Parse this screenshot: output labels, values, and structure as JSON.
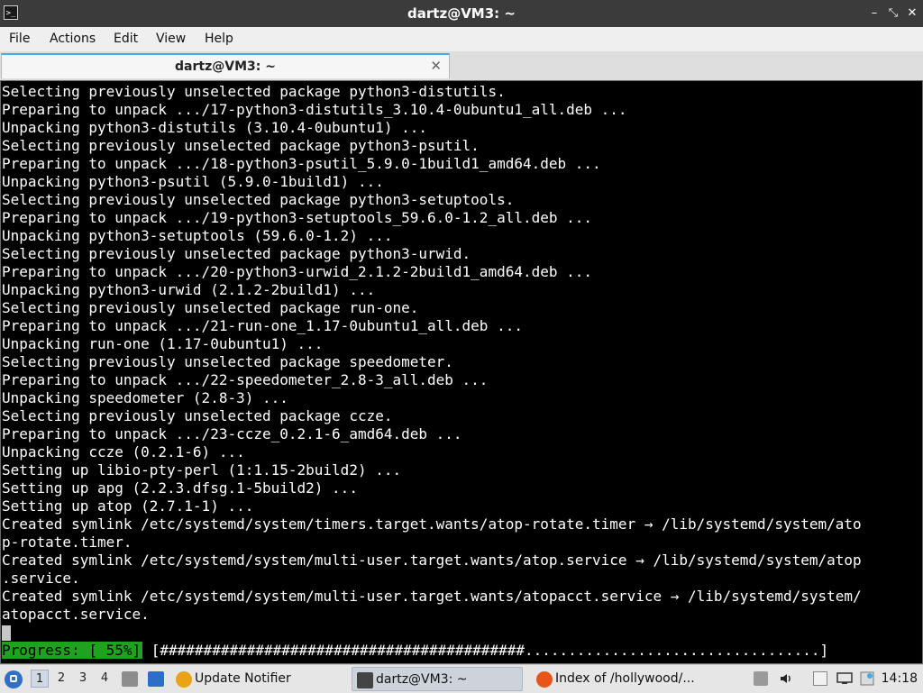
{
  "window": {
    "title": "dartz@VM3: ~",
    "app_icon": "terminal-icon",
    "controls": {
      "minimize": "–",
      "maximize": "⤡",
      "close": "✕"
    }
  },
  "menubar": {
    "items": [
      "File",
      "Actions",
      "Edit",
      "View",
      "Help"
    ]
  },
  "tabs": [
    {
      "label": "dartz@VM3: ~",
      "close": "✕"
    }
  ],
  "terminal": {
    "lines": [
      "Selecting previously unselected package python3-distutils.",
      "Preparing to unpack .../17-python3-distutils_3.10.4-0ubuntu1_all.deb ...",
      "Unpacking python3-distutils (3.10.4-0ubuntu1) ...",
      "Selecting previously unselected package python3-psutil.",
      "Preparing to unpack .../18-python3-psutil_5.9.0-1build1_amd64.deb ...",
      "Unpacking python3-psutil (5.9.0-1build1) ...",
      "Selecting previously unselected package python3-setuptools.",
      "Preparing to unpack .../19-python3-setuptools_59.6.0-1.2_all.deb ...",
      "Unpacking python3-setuptools (59.6.0-1.2) ...",
      "Selecting previously unselected package python3-urwid.",
      "Preparing to unpack .../20-python3-urwid_2.1.2-2build1_amd64.deb ...",
      "Unpacking python3-urwid (2.1.2-2build1) ...",
      "Selecting previously unselected package run-one.",
      "Preparing to unpack .../21-run-one_1.17-0ubuntu1_all.deb ...",
      "Unpacking run-one (1.17-0ubuntu1) ...",
      "Selecting previously unselected package speedometer.",
      "Preparing to unpack .../22-speedometer_2.8-3_all.deb ...",
      "Unpacking speedometer (2.8-3) ...",
      "Selecting previously unselected package ccze.",
      "Preparing to unpack .../23-ccze_0.2.1-6_amd64.deb ...",
      "Unpacking ccze (0.2.1-6) ...",
      "Setting up libio-pty-perl (1:1.15-2build2) ...",
      "Setting up apg (2.2.3.dfsg.1-5build2) ...",
      "Setting up atop (2.7.1-1) ...",
      "Created symlink /etc/systemd/system/timers.target.wants/atop-rotate.timer → /lib/systemd/system/ato",
      "p-rotate.timer.",
      "Created symlink /etc/systemd/system/multi-user.target.wants/atop.service → /lib/systemd/system/atop",
      ".service.",
      "Created symlink /etc/systemd/system/multi-user.target.wants/atopacct.service → /lib/systemd/system/",
      "atopacct.service."
    ],
    "progress": {
      "label": "Progress: [ 55%]",
      "bar": " [##########################################..................................]",
      "percent": 55
    }
  },
  "taskbar": {
    "start_icon": "menu-icon",
    "workspaces": [
      "1",
      "2",
      "3",
      "4"
    ],
    "active_workspace": "1",
    "tasks": [
      {
        "label": "Update Notifier",
        "icon": "update-notifier-icon",
        "color": "#e8a317"
      },
      {
        "label": "dartz@VM3: ~",
        "icon": "terminal-icon",
        "color": "#444444"
      },
      {
        "label": "Index of /hollywood/...",
        "icon": "firefox-icon",
        "color": "#e8551b"
      }
    ],
    "clock": "14:18"
  },
  "colors": {
    "titlebar": "#3b3b3b",
    "terminal_bg": "#000000",
    "progress_green": "#1fa31f",
    "accent": "#3daee9"
  }
}
